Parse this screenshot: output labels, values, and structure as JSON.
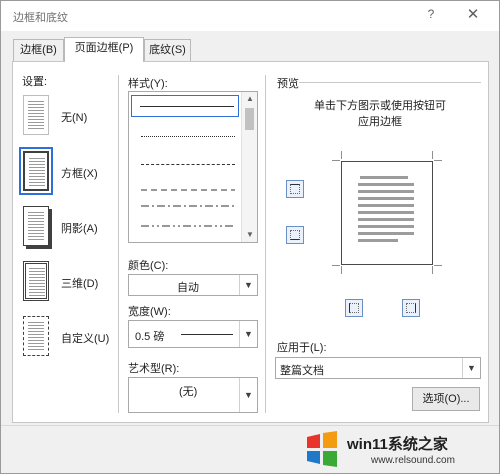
{
  "window": {
    "title": "边框和底纹",
    "help": "?",
    "close": "✕"
  },
  "tabs": [
    {
      "label": "边框(B)",
      "active": false
    },
    {
      "label": "页面边框(P)",
      "active": true
    },
    {
      "label": "底纹(S)",
      "active": false
    }
  ],
  "settings": {
    "label": "设置:",
    "items": [
      {
        "label": "无(N)",
        "selected": false
      },
      {
        "label": "方框(X)",
        "selected": true
      },
      {
        "label": "阴影(A)",
        "selected": false
      },
      {
        "label": "三维(D)",
        "selected": false
      },
      {
        "label": "自定义(U)",
        "selected": false
      }
    ]
  },
  "style": {
    "label": "样式(Y):",
    "rows": [
      "solid",
      "dotted",
      "dashed-small",
      "dashed",
      "dash-dot",
      "dash-dot-dot"
    ]
  },
  "color": {
    "label": "颜色(C):",
    "value": "自动"
  },
  "width": {
    "label": "宽度(W):",
    "value": "0.5 磅"
  },
  "art": {
    "label": "艺术型(R):",
    "value": "(无)"
  },
  "preview": {
    "label": "预览",
    "hint_line1": "单击下方图示或使用按钮可",
    "hint_line2": "应用边框"
  },
  "apply_to": {
    "label": "应用于(L):",
    "value": "整篇文档"
  },
  "options_button": "选项(O)...",
  "watermark": {
    "title": "win11系统之家",
    "url": "www.relsound.com"
  },
  "colors": {
    "accent": "#2e6fd8",
    "logo_red": "#e8342a",
    "logo_orange": "#f39c12",
    "logo_green": "#3aa935",
    "logo_blue": "#1f78c8"
  }
}
